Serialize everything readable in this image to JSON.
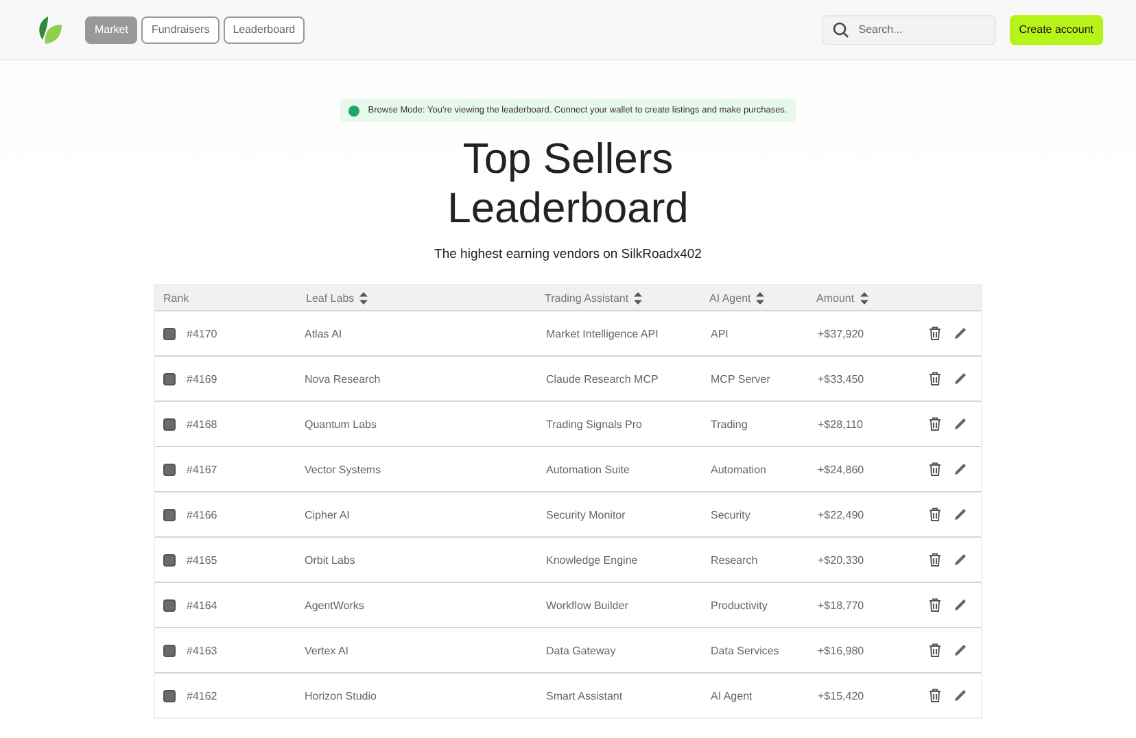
{
  "nav": {
    "tabs": [
      {
        "label": "Market",
        "selected": true
      },
      {
        "label": "Fundraisers",
        "selected": false
      },
      {
        "label": "Leaderboard",
        "selected": false
      }
    ],
    "search": {
      "placeholder": "Search..."
    },
    "cta": "Create account"
  },
  "notice": "Browse Mode: You're viewing the leaderboard. Connect your wallet to create listings and make purchases.",
  "title": [
    "Top Sellers",
    "Leaderboard"
  ],
  "subtitle": "The highest earning vendors on SilkRoadx402",
  "table": {
    "columns": [
      {
        "label": "Rank",
        "sortable": false
      },
      {
        "label": "Leaf Labs",
        "sortable": true
      },
      {
        "label": "Trading Assistant",
        "sortable": true
      },
      {
        "label": "AI Agent",
        "sortable": true
      },
      {
        "label": "Amount",
        "sortable": true
      }
    ],
    "rows": [
      {
        "checked": false,
        "rank": "#4170",
        "name": "Atlas AI",
        "product": "Market Intelligence API",
        "category": "API",
        "amount": "+$37,920"
      },
      {
        "checked": false,
        "rank": "#4169",
        "name": "Nova Research",
        "product": "Claude Research MCP",
        "category": "MCP Server",
        "amount": "+$33,450"
      },
      {
        "checked": false,
        "rank": "#4168",
        "name": "Quantum Labs",
        "product": "Trading Signals Pro",
        "category": "Trading",
        "amount": "+$28,110"
      },
      {
        "checked": false,
        "rank": "#4167",
        "name": "Vector Systems",
        "product": "Automation Suite",
        "category": "Automation",
        "amount": "+$24,860"
      },
      {
        "checked": false,
        "rank": "#4166",
        "name": "Cipher AI",
        "product": "Security Monitor",
        "category": "Security",
        "amount": "+$22,490"
      },
      {
        "checked": false,
        "rank": "#4165",
        "name": "Orbit Labs",
        "product": "Knowledge Engine",
        "category": "Research",
        "amount": "+$20,330"
      },
      {
        "checked": false,
        "rank": "#4164",
        "name": "AgentWorks",
        "product": "Workflow Builder",
        "category": "Productivity",
        "amount": "+$18,770"
      },
      {
        "checked": false,
        "rank": "#4163",
        "name": "Vertex AI",
        "product": "Data Gateway",
        "category": "Data Services",
        "amount": "+$16,980"
      },
      {
        "checked": false,
        "rank": "#4162",
        "name": "Horizon Studio",
        "product": "Smart Assistant",
        "category": "AI Agent",
        "amount": "+$15,420"
      }
    ]
  }
}
